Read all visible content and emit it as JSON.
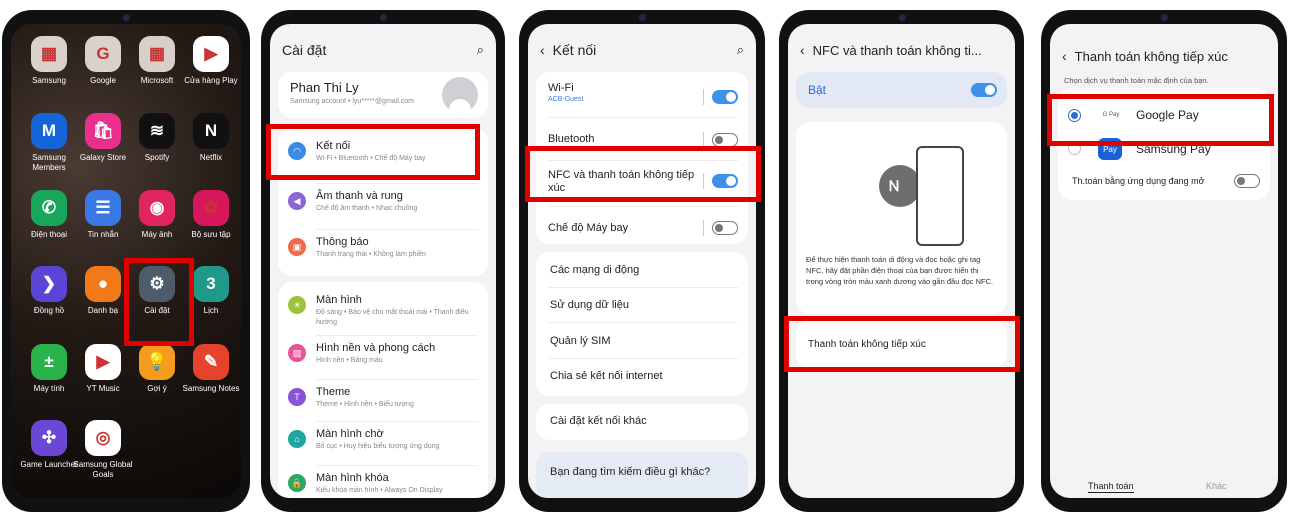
{
  "home": {
    "apps": [
      {
        "label": "Samsung",
        "icon": "samsung-folder-icon",
        "color": "#d9d2cc",
        "glyph": "▦"
      },
      {
        "label": "Google",
        "icon": "google-folder-icon",
        "color": "#d9d2cc",
        "glyph": "G"
      },
      {
        "label": "Microsoft",
        "icon": "microsoft-folder-icon",
        "color": "#d6cfca",
        "glyph": "▦"
      },
      {
        "label": "Cửa hàng Play",
        "icon": "play-store-icon",
        "color": "#ffffff",
        "glyph": "▶"
      },
      {
        "label": "Samsung Members",
        "icon": "samsung-members-icon",
        "color": "#1565d8",
        "glyph": "M"
      },
      {
        "label": "Galaxy Store",
        "icon": "galaxy-store-icon",
        "color": "#e8308c",
        "glyph": "🛍"
      },
      {
        "label": "Spotify",
        "icon": "spotify-icon",
        "color": "#111111",
        "glyph": "≋"
      },
      {
        "label": "Netflix",
        "icon": "netflix-icon",
        "color": "#111111",
        "glyph": "N"
      },
      {
        "label": "Điện thoại",
        "icon": "phone-icon",
        "color": "#18a65a",
        "glyph": "✆"
      },
      {
        "label": "Tin nhắn",
        "icon": "messages-icon",
        "color": "#3a78e6",
        "glyph": "☰"
      },
      {
        "label": "Máy ảnh",
        "icon": "camera-icon",
        "color": "#e0245e",
        "glyph": "◉"
      },
      {
        "label": "Bộ sưu tập",
        "icon": "gallery-icon",
        "color": "#d8175a",
        "glyph": "✿"
      },
      {
        "label": "Đồng hồ",
        "icon": "clock-icon",
        "color": "#5a45d6",
        "glyph": "❯"
      },
      {
        "label": "Danh bạ",
        "icon": "contacts-icon",
        "color": "#f07a1a",
        "glyph": "●"
      },
      {
        "label": "Cài đặt",
        "icon": "gear-icon",
        "color": "#4d5b6b",
        "glyph": "⚙"
      },
      {
        "label": "Lịch",
        "icon": "calendar-icon",
        "color": "#1f9a8a",
        "glyph": "3"
      },
      {
        "label": "Máy tính",
        "icon": "calculator-icon",
        "color": "#2bb24a",
        "glyph": "±"
      },
      {
        "label": "YT Music",
        "icon": "yt-music-icon",
        "color": "#ffffff",
        "glyph": "▶"
      },
      {
        "label": "Gợi ý",
        "icon": "tips-icon",
        "color": "#f39c1e",
        "glyph": "💡"
      },
      {
        "label": "Samsung Notes",
        "icon": "samsung-notes-icon",
        "color": "#e5432c",
        "glyph": "✎"
      },
      {
        "label": "Game Launcher",
        "icon": "game-launcher-icon",
        "color": "#6b47d6",
        "glyph": "✣"
      },
      {
        "label": "Samsung Global Goals",
        "icon": "global-goals-icon",
        "color": "#ffffff",
        "glyph": "◎"
      }
    ]
  },
  "settings": {
    "title": "Cài đặt",
    "profile_name": "Phan Thi Ly",
    "profile_sub": "Samsung account  •  lyu*****@gmail.com",
    "items": [
      {
        "title": "Kết nối",
        "sub": "Wi-Fi  •  Bluetooth  •  Chế độ Máy bay",
        "color": "#3a8be8",
        "glyph": "◠",
        "icon": "wifi-icon"
      },
      {
        "title": "Âm thanh và rung",
        "sub": "Chế độ âm thanh  •  Nhạc chuông",
        "color": "#8a66d6",
        "glyph": "◀",
        "icon": "sound-icon"
      },
      {
        "title": "Thông báo",
        "sub": "Thanh trạng thái  •  Không làm phiền",
        "color": "#ef6a4a",
        "glyph": "▣",
        "icon": "notification-icon"
      },
      {
        "title": "Màn hình",
        "sub": "Độ sáng  •  Bảo vệ cho mắt thoải mái  •  Thanh điều hướng",
        "color": "#9ac43a",
        "glyph": "☀",
        "icon": "display-icon"
      },
      {
        "title": "Hình nền và phong cách",
        "sub": "Hình nền  •  Bảng màu",
        "color": "#e8549a",
        "glyph": "▨",
        "icon": "wallpaper-icon"
      },
      {
        "title": "Theme",
        "sub": "Theme  •  Hình nền  •  Biểu tượng",
        "color": "#8a52d6",
        "glyph": "T",
        "icon": "theme-icon"
      },
      {
        "title": "Màn hình chờ",
        "sub": "Bố cục  •  Huy hiệu biểu tượng ứng dụng",
        "color": "#1fa6a0",
        "glyph": "⌂",
        "icon": "home-screen-icon"
      },
      {
        "title": "Màn hình khóa",
        "sub": "Kiểu khóa màn hình  •  Always On Display",
        "color": "#2aa860",
        "glyph": "🔒",
        "icon": "lock-icon"
      }
    ]
  },
  "connections": {
    "title": "Kết nối",
    "wifi_title": "Wi-Fi",
    "wifi_ssid": "ACB-Guest",
    "bluetooth": "Bluetooth",
    "nfc": "NFC và thanh toán không tiếp xúc",
    "airplane": "Chế độ Máy bay",
    "mobile_networks": "Các mạng di động",
    "data_usage": "Sử dụng dữ liệu",
    "sim_manager": "Quản lý SIM",
    "hotspot": "Chia sẻ kết nối internet",
    "more": "Cài đặt kết nối khác",
    "looking": "Bạn đang tìm kiếm điều gì khác?"
  },
  "nfc": {
    "title": "NFC và thanh toán không ti...",
    "on_label": "Bật",
    "description": "Để thực hiện thanh toán di động và đọc hoặc ghi tag NFC, hãy đặt phần điện thoại của bạn được hiển thị trong vòng tròn màu xanh dương vào gần đầu đọc NFC.",
    "contactless": "Thanh toán không tiếp xúc"
  },
  "payment": {
    "title": "Thanh toán không tiếp xúc",
    "hint": "Chọn dịch vụ thanh toán mặc định của bạn.",
    "option1": "Google Pay",
    "option2": "Samsung Pay",
    "open_app": "Th.toán bằng ứng dụng đang mở",
    "tab_pay": "Thanh toán",
    "tab_other": "Khác",
    "gpay_logo": "G Pay",
    "spay_logo": "Pay"
  }
}
